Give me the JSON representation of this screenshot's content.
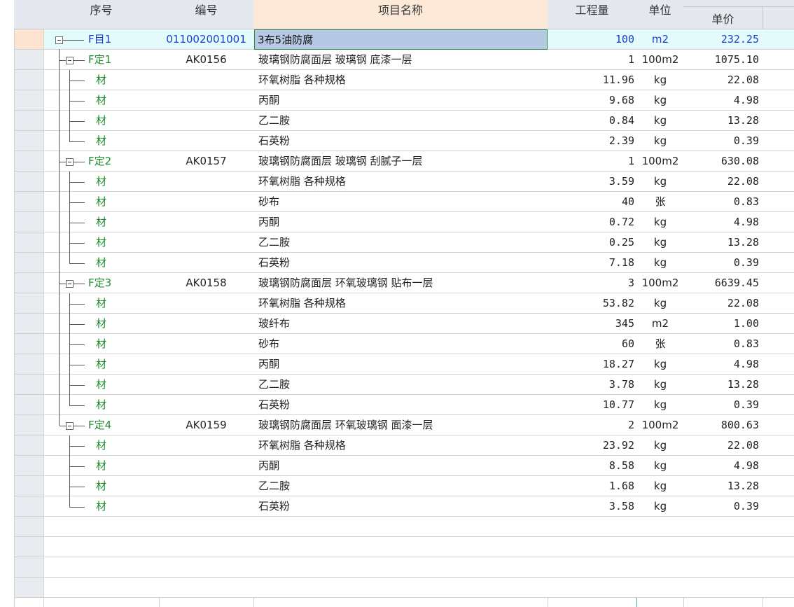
{
  "columns": {
    "seq": "序号",
    "code": "编号",
    "name": "项目名称",
    "qty": "工程量",
    "unit": "单位",
    "price": "单价"
  },
  "colors": {
    "header_bg": "#e5e9ef",
    "selected_row_bg": "#e3fbfb",
    "selected_name_bg": "#b7c8e4",
    "blue_text": "#1a3fd0",
    "green_text": "#1e8a2e",
    "row_marker": "#fce4d0"
  },
  "rows": [
    {
      "seq": "F目1",
      "code": "011002001001",
      "name": "3布5油防腐",
      "qty": "100",
      "unit": "m2",
      "price": "232.25",
      "kind": "item"
    },
    {
      "seq": "F定1",
      "code": "AK0156",
      "name": "玻璃钢防腐面层 玻璃钢 底漆一层",
      "qty": "1",
      "unit": "100m2",
      "price": "1075.10",
      "kind": "quota"
    },
    {
      "seq": "材",
      "code": "",
      "name": "环氧树脂 各种规格",
      "qty": "11.96",
      "unit": "kg",
      "price": "22.08",
      "kind": "mat"
    },
    {
      "seq": "材",
      "code": "",
      "name": "丙酮",
      "qty": "9.68",
      "unit": "kg",
      "price": "4.98",
      "kind": "mat"
    },
    {
      "seq": "材",
      "code": "",
      "name": "乙二胺",
      "qty": "0.84",
      "unit": "kg",
      "price": "13.28",
      "kind": "mat"
    },
    {
      "seq": "材",
      "code": "",
      "name": "石英粉",
      "qty": "2.39",
      "unit": "kg",
      "price": "0.39",
      "kind": "mat",
      "last": true
    },
    {
      "seq": "F定2",
      "code": "AK0157",
      "name": "玻璃钢防腐面层 玻璃钢 刮腻子一层",
      "qty": "1",
      "unit": "100m2",
      "price": "630.08",
      "kind": "quota"
    },
    {
      "seq": "材",
      "code": "",
      "name": "环氧树脂 各种规格",
      "qty": "3.59",
      "unit": "kg",
      "price": "22.08",
      "kind": "mat"
    },
    {
      "seq": "材",
      "code": "",
      "name": "砂布",
      "qty": "40",
      "unit": "张",
      "price": "0.83",
      "kind": "mat"
    },
    {
      "seq": "材",
      "code": "",
      "name": "丙酮",
      "qty": "0.72",
      "unit": "kg",
      "price": "4.98",
      "kind": "mat"
    },
    {
      "seq": "材",
      "code": "",
      "name": "乙二胺",
      "qty": "0.25",
      "unit": "kg",
      "price": "13.28",
      "kind": "mat"
    },
    {
      "seq": "材",
      "code": "",
      "name": "石英粉",
      "qty": "7.18",
      "unit": "kg",
      "price": "0.39",
      "kind": "mat",
      "last": true
    },
    {
      "seq": "F定3",
      "code": "AK0158",
      "name": "玻璃钢防腐面层 环氧玻璃钢 贴布一层",
      "qty": "3",
      "unit": "100m2",
      "price": "6639.45",
      "kind": "quota"
    },
    {
      "seq": "材",
      "code": "",
      "name": "环氧树脂 各种规格",
      "qty": "53.82",
      "unit": "kg",
      "price": "22.08",
      "kind": "mat"
    },
    {
      "seq": "材",
      "code": "",
      "name": "玻纤布",
      "qty": "345",
      "unit": "m2",
      "price": "1.00",
      "kind": "mat"
    },
    {
      "seq": "材",
      "code": "",
      "name": "砂布",
      "qty": "60",
      "unit": "张",
      "price": "0.83",
      "kind": "mat"
    },
    {
      "seq": "材",
      "code": "",
      "name": "丙酮",
      "qty": "18.27",
      "unit": "kg",
      "price": "4.98",
      "kind": "mat"
    },
    {
      "seq": "材",
      "code": "",
      "name": "乙二胺",
      "qty": "3.78",
      "unit": "kg",
      "price": "13.28",
      "kind": "mat"
    },
    {
      "seq": "材",
      "code": "",
      "name": "石英粉",
      "qty": "10.77",
      "unit": "kg",
      "price": "0.39",
      "kind": "mat",
      "last": true
    },
    {
      "seq": "F定4",
      "code": "AK0159",
      "name": "玻璃钢防腐面层 环氧玻璃钢 面漆一层",
      "qty": "2",
      "unit": "100m2",
      "price": "800.63",
      "kind": "quota",
      "lastQuota": true
    },
    {
      "seq": "材",
      "code": "",
      "name": "环氧树脂 各种规格",
      "qty": "23.92",
      "unit": "kg",
      "price": "22.08",
      "kind": "mat"
    },
    {
      "seq": "材",
      "code": "",
      "name": "丙酮",
      "qty": "8.58",
      "unit": "kg",
      "price": "4.98",
      "kind": "mat"
    },
    {
      "seq": "材",
      "code": "",
      "name": "乙二胺",
      "qty": "1.68",
      "unit": "kg",
      "price": "13.28",
      "kind": "mat"
    },
    {
      "seq": "材",
      "code": "",
      "name": "石英粉",
      "qty": "3.58",
      "unit": "kg",
      "price": "0.39",
      "kind": "mat",
      "last": true
    }
  ]
}
